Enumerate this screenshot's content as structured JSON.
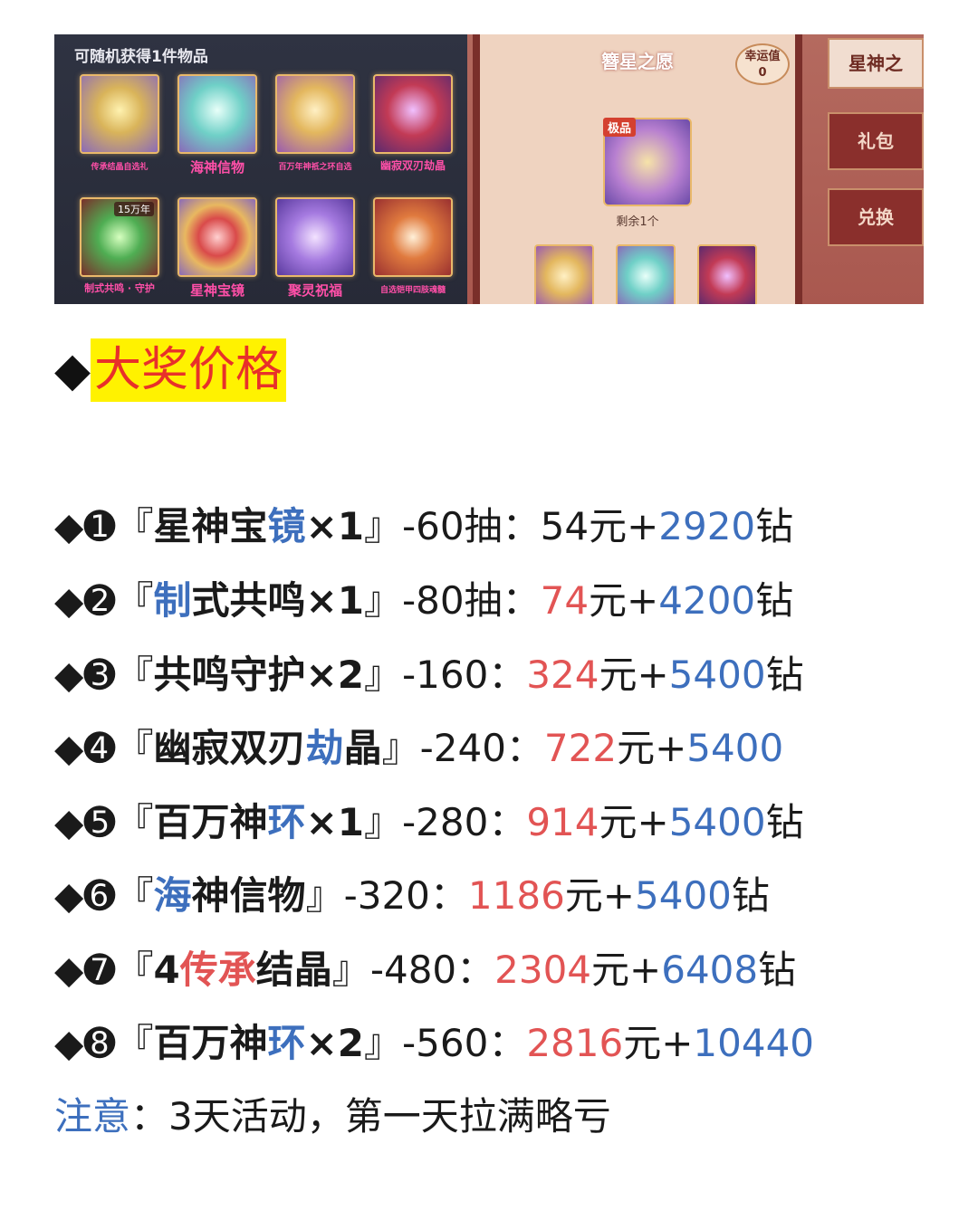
{
  "screenshot": {
    "panel_title": "可随机获得1件物品",
    "items": [
      {
        "label": "传承结晶自选礼",
        "icon": "crystal-emblem-icon",
        "color": "#d9b45a"
      },
      {
        "label": "海神信物",
        "icon": "token-icon",
        "color": "#6fd0c7"
      },
      {
        "label": "百万年神祇之环自选",
        "icon": "treasure-chest-icon",
        "color": "#e3b75e"
      },
      {
        "label": "幽寂双刃劫晶",
        "icon": "blade-crystal-icon",
        "color": "#c23a55"
      },
      {
        "label": "制式共鸣 · 守护",
        "icon": "resonance-icon",
        "color": "#4fae53",
        "badge": "15万年"
      },
      {
        "label": "星神宝镜",
        "icon": "mirror-icon",
        "color": "#d94a4a"
      },
      {
        "label": "聚灵祝福",
        "icon": "blessing-icon",
        "color": "#a57ae0"
      },
      {
        "label": "自选铠甲四肢魂髓",
        "icon": "armor-icon",
        "color": "#e07a3e"
      }
    ],
    "dialog_title": "簪星之愿",
    "luck_label": "幸运值",
    "luck_value": "0",
    "featured_tag": "极品",
    "remaining": "剩余1个",
    "tabs": [
      "星神之",
      "礼包",
      "兑换"
    ]
  },
  "heading": {
    "diamond": "◆",
    "text": "大奖价格"
  },
  "prices": [
    {
      "num": "➊",
      "name_a": "星神宝",
      "name_b": "镜",
      "name_c": "×1",
      "draws": "-60抽：",
      "rmb": "54",
      "rmb_unit": "元+",
      "diamonds": "2920",
      "diamond_unit": "钻"
    },
    {
      "num": "➋",
      "name_a": "",
      "name_b": "制",
      "name_c": "式共鸣×1",
      "draws": "-80抽：",
      "rmb": "74",
      "rmb_unit": "元+",
      "diamonds": "4200",
      "diamond_unit": "钻"
    },
    {
      "num": "➌",
      "name_a": "共鸣守护×2",
      "name_b": "",
      "name_c": "",
      "draws": "-160：",
      "rmb": "324",
      "rmb_unit": "元+",
      "diamonds": "5400",
      "diamond_unit": "钻"
    },
    {
      "num": "➍",
      "name_a": "幽寂双刃",
      "name_b": "劫",
      "name_c": "晶",
      "draws": "-240：",
      "rmb": "722",
      "rmb_unit": "元+",
      "diamonds": "5400",
      "diamond_unit": ""
    },
    {
      "num": "➎",
      "name_a": "百万神",
      "name_b": "环",
      "name_c": "×1",
      "draws": "-280：",
      "rmb": "914",
      "rmb_unit": "元+",
      "diamonds": "5400",
      "diamond_unit": "钻"
    },
    {
      "num": "➏",
      "name_a": "",
      "name_b": "海",
      "name_c": "神信物",
      "draws": "-320：",
      "rmb": "1186",
      "rmb_unit": "元+",
      "diamonds": "5400",
      "diamond_unit": "钻"
    },
    {
      "num": "➐",
      "name_a": "4",
      "name_red": "传承",
      "name_b": "",
      "name_c": "结晶",
      "draws": "-480：",
      "rmb": "2304",
      "rmb_unit": "元+",
      "diamonds": "6408",
      "diamond_unit": "钻"
    },
    {
      "num": "➑",
      "name_a": "百万神",
      "name_b": "环",
      "name_c": "×2",
      "draws": "-560：",
      "rmb": "2816",
      "rmb_unit": "元+",
      "diamonds": "10440",
      "diamond_unit": ""
    }
  ],
  "brackets": {
    "open": "『",
    "close": "』"
  },
  "note": {
    "label": "注意",
    "text": "：3天活动，第一天拉满略亏"
  },
  "colors": {
    "blue": "#3d6fbd",
    "red": "#e25454",
    "highlight": "#fff200",
    "heading_red": "#e8302a"
  }
}
